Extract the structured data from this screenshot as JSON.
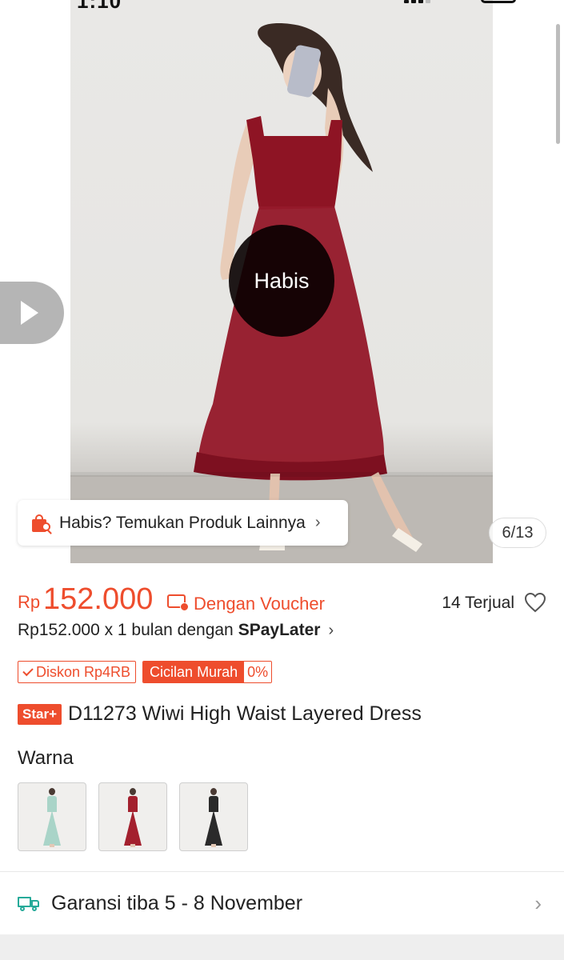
{
  "status_bar": {
    "time": "1:10"
  },
  "gallery": {
    "overlay_label": "Habis",
    "find_more_label": "Habis? Temukan Produk Lainnya",
    "counter": "6/13",
    "has_video": true
  },
  "price": {
    "currency": "Rp",
    "amount": "152.000",
    "voucher_label": "Dengan Voucher",
    "sold": "14 Terjual"
  },
  "paylater": {
    "text": "Rp152.000 x 1 bulan dengan",
    "brand": "SPayLater"
  },
  "tags": {
    "discount": "Diskon Rp4RB",
    "installment_label": "Cicilan Murah",
    "installment_rate": "0%"
  },
  "product": {
    "badge": "Star+",
    "title": "D11273 Wiwi High Waist Layered Dress"
  },
  "variants": {
    "label": "Warna",
    "items": [
      {
        "name": "mint",
        "color": "#a9d4c8"
      },
      {
        "name": "red",
        "color": "#a3202e"
      },
      {
        "name": "black",
        "color": "#2a2a2a"
      }
    ]
  },
  "shipping": {
    "label": "Garansi tiba 5 - 8 November"
  },
  "colors": {
    "accent": "#ee4d2d",
    "shipping": "#26aa99",
    "dress": "#8e1424"
  }
}
